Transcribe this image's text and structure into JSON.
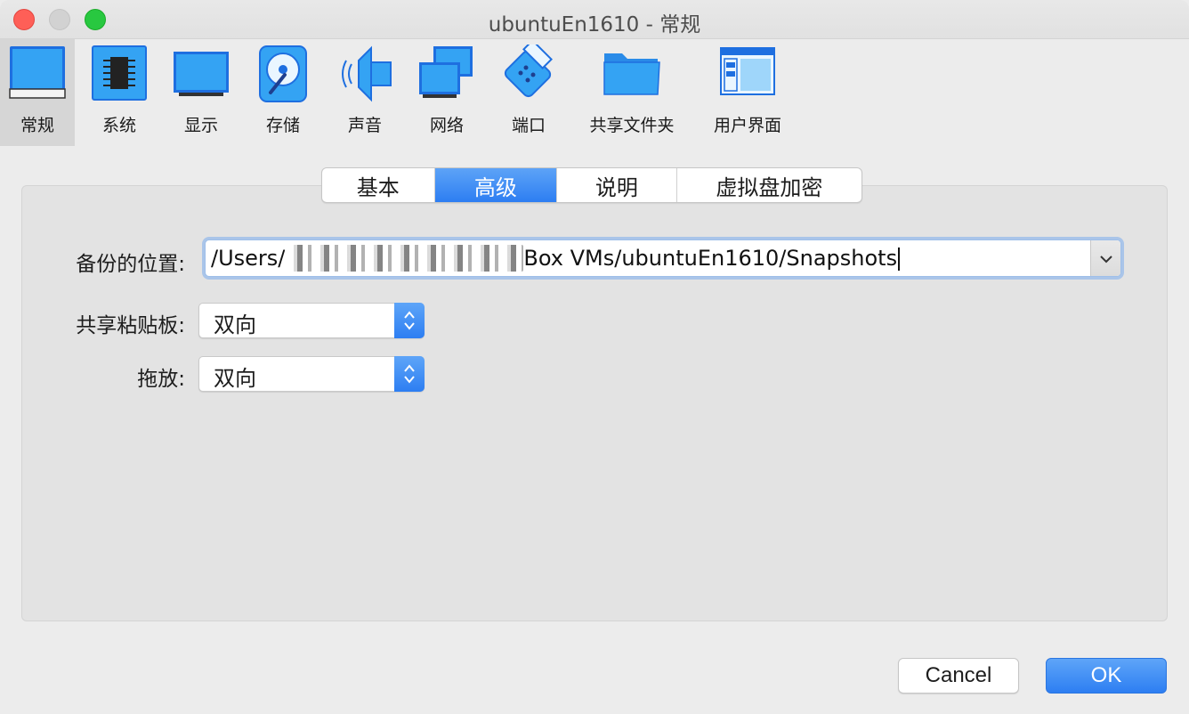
{
  "window": {
    "title": "ubuntuEn1610 - 常规"
  },
  "toolbar": {
    "items": [
      {
        "label": "常规",
        "icon": "general-icon",
        "selected": true
      },
      {
        "label": "系统",
        "icon": "chip-icon",
        "selected": false
      },
      {
        "label": "显示",
        "icon": "monitor-icon",
        "selected": false
      },
      {
        "label": "存储",
        "icon": "disk-icon",
        "selected": false
      },
      {
        "label": "声音",
        "icon": "speaker-icon",
        "selected": false
      },
      {
        "label": "网络",
        "icon": "network-icon",
        "selected": false
      },
      {
        "label": "端口",
        "icon": "port-icon",
        "selected": false
      },
      {
        "label": "共享文件夹",
        "icon": "folder-icon",
        "selected": false
      },
      {
        "label": "用户界面",
        "icon": "ui-window-icon",
        "selected": false
      }
    ]
  },
  "tabs": [
    {
      "label": "基本",
      "active": false
    },
    {
      "label": "高级",
      "active": true
    },
    {
      "label": "说明",
      "active": false
    },
    {
      "label": "虚拟盘加密",
      "active": false
    }
  ],
  "form": {
    "snapshot_folder": {
      "label": "备份的位置:",
      "value_prefix": "/Users/",
      "value_suffix": "Box VMs/ubuntuEn1610/Snapshots"
    },
    "shared_clipboard": {
      "label": "共享粘贴板:",
      "value": "双向"
    },
    "drag_drop": {
      "label": "拖放:",
      "value": "双向"
    }
  },
  "buttons": {
    "cancel": "Cancel",
    "ok": "OK"
  },
  "colors": {
    "accent": "#2d7ef2",
    "selected_tool": "#d6d6d6"
  }
}
